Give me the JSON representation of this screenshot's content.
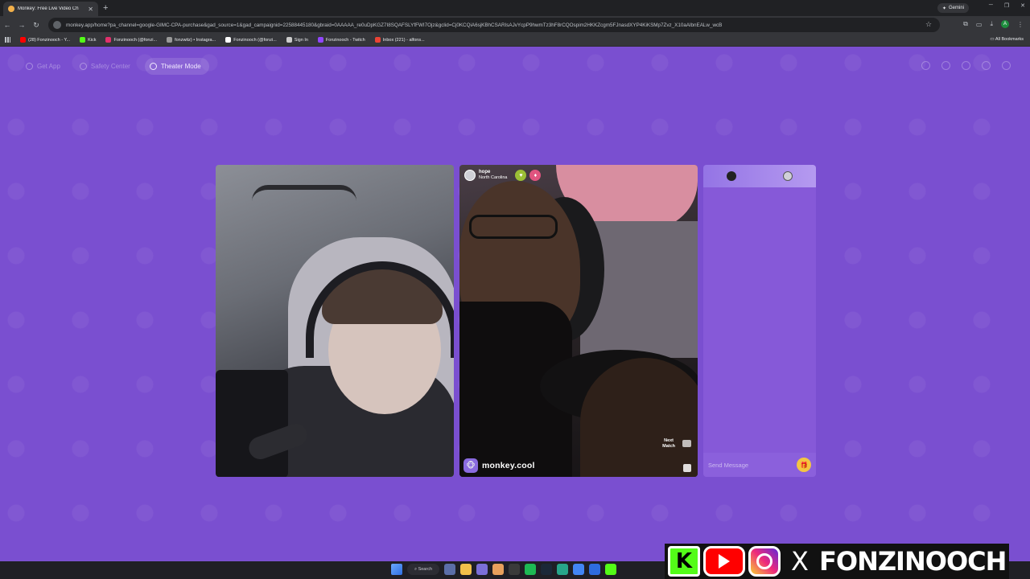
{
  "browser": {
    "tab_title": "Monkey: Free Live Video Ch",
    "gemini_label": "Gemini",
    "url": "monkey.app/home?pa_channel=google-GIMC-CPA-purchase&gad_source=1&gad_campaignid=22588445180&gbraid=0AAAAA_re0uDpKGZ7I8SQAFSLYfFWI7Ojz&gclid=Cj0KCQiA6sjKBhCSARIsAJvYcpP9hwmTz3hF8rCQOspim2HKKZcgm5FJnasdXYP4KiKSMp7Zvz_X10aAlbnEALw_wcB",
    "bookmarks": [
      {
        "label": "(28) Fonzinooch - Y...",
        "color": "#ff0000"
      },
      {
        "label": "Kick",
        "color": "#53fc18"
      },
      {
        "label": "Fonzinooch (@fonzi...",
        "color": "#e1306c"
      },
      {
        "label": "fonzwitz) • Instagra...",
        "color": "#999999"
      },
      {
        "label": "Fonzinooch (@fonzi...",
        "color": "#ffffff"
      },
      {
        "label": "Sign In",
        "color": "#cccccc"
      },
      {
        "label": "Fonzinooch - Twitch",
        "color": "#9146ff"
      },
      {
        "label": "Inbox (221) - alfons...",
        "color": "#ea4335"
      }
    ],
    "all_bookmarks": "All Bookmarks",
    "profile_initial": "A"
  },
  "app": {
    "nav": {
      "get_app": "Get App",
      "safety_center": "Safety Center",
      "theater_mode": "Theater Mode"
    },
    "remote_user": {
      "name": "hope",
      "location": "North Carolina"
    },
    "watermark": "monkey.cool",
    "next_match_line1": "Next",
    "next_match_line2": "Match",
    "chat_placeholder": "Send Message"
  },
  "taskbar": {
    "search_label": "Search"
  },
  "overlay": {
    "kick_letter": "K",
    "x_letter": "X",
    "name": "FONZINOOCH"
  },
  "colors": {
    "page_bg": "#7a4fd0",
    "chat_bg": "#8659d8",
    "kick_green": "#53fc18",
    "youtube_red": "#ff0000"
  }
}
